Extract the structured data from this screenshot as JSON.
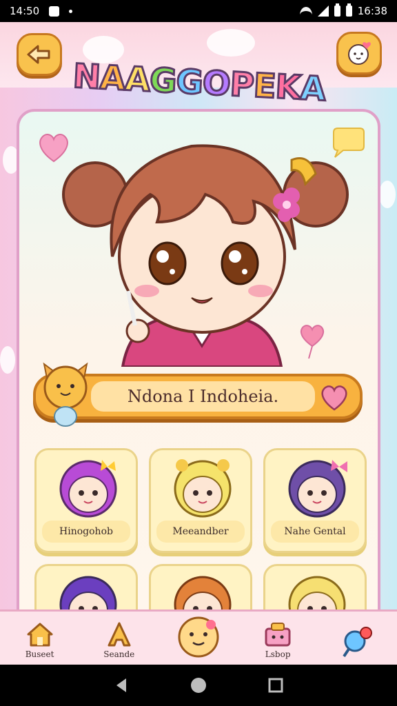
{
  "status_bar": {
    "time_left": "14:50",
    "time_right": "16:38"
  },
  "app": {
    "logo_text": "NAAGGOPEKA",
    "logo_colors": [
      "#ff7fa8",
      "#ffb347",
      "#ffe066",
      "#7ed957",
      "#6ec6ff",
      "#b57bff",
      "#ff7fa8",
      "#ffb347",
      "#ff6fa0",
      "#7ed1ff"
    ]
  },
  "featured": {
    "name": "Ndona I Indoheia."
  },
  "characters": [
    {
      "label": "Hinogohob",
      "hair": "#b84bd6",
      "bow": "#ffcc33"
    },
    {
      "label": "Meeandber",
      "hair": "#f5e36b",
      "bow": "#f5c94a"
    },
    {
      "label": "Nahe Gental",
      "hair": "#6f4fa8",
      "bow": "#f06fb0"
    },
    {
      "label": "",
      "hair": "#6b3fbf",
      "bow": "#ff88cc"
    },
    {
      "label": "",
      "hair": "#e3823a",
      "bow": "#e3823a"
    },
    {
      "label": "",
      "hair": "#f6df72",
      "bow": "#f6c445"
    }
  ],
  "bottom_nav": [
    {
      "label": "Buseet"
    },
    {
      "label": "Seande"
    },
    {
      "label": ""
    },
    {
      "label": "Lsbop"
    },
    {
      "label": ""
    }
  ],
  "colors": {
    "accent_orange": "#f8b23f",
    "card_border": "#e0a0c8",
    "nav_bg": "#fde3ea"
  }
}
